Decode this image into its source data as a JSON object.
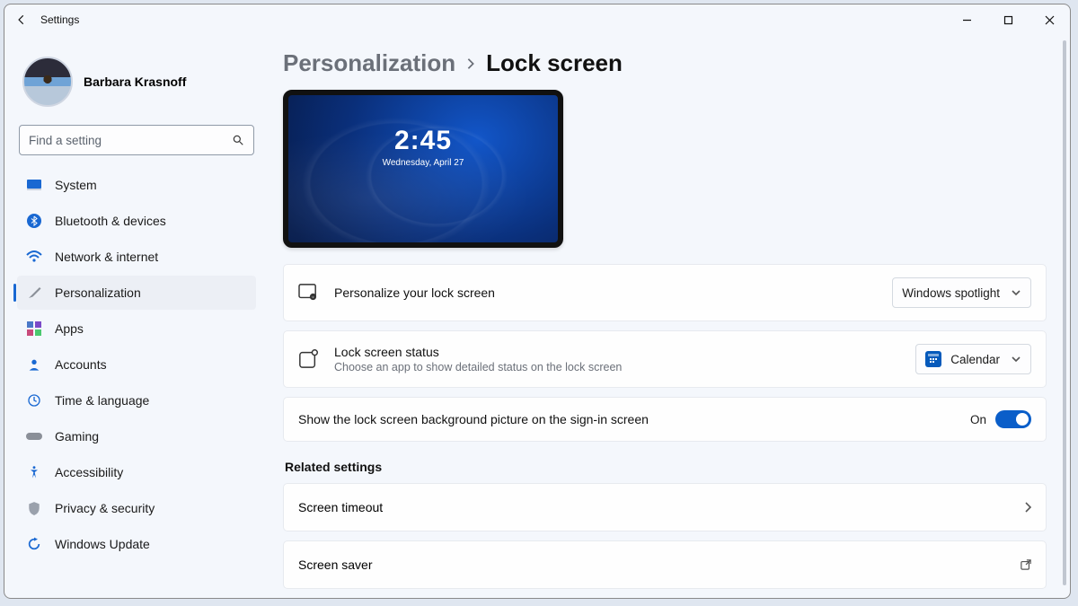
{
  "window": {
    "title": "Settings"
  },
  "profile": {
    "name": "Barbara Krasnoff"
  },
  "search": {
    "placeholder": "Find a setting"
  },
  "sidebar": {
    "items": [
      {
        "label": "System"
      },
      {
        "label": "Bluetooth & devices"
      },
      {
        "label": "Network & internet"
      },
      {
        "label": "Personalization"
      },
      {
        "label": "Apps"
      },
      {
        "label": "Accounts"
      },
      {
        "label": "Time & language"
      },
      {
        "label": "Gaming"
      },
      {
        "label": "Accessibility"
      },
      {
        "label": "Privacy & security"
      },
      {
        "label": "Windows Update"
      }
    ],
    "selected_index": 3
  },
  "breadcrumb": {
    "parent": "Personalization",
    "current": "Lock screen"
  },
  "preview": {
    "time": "2:45",
    "date": "Wednesday, April 27"
  },
  "cards": {
    "personalize": {
      "title": "Personalize your lock screen",
      "select_value": "Windows spotlight"
    },
    "status": {
      "title": "Lock screen status",
      "sub": "Choose an app to show detailed status on the lock screen",
      "select_value": "Calendar"
    },
    "signin_picture": {
      "title": "Show the lock screen background picture on the sign-in screen",
      "toggle_label": "On",
      "toggle_on": true
    }
  },
  "related": {
    "heading": "Related settings",
    "items": [
      {
        "label": "Screen timeout"
      },
      {
        "label": "Screen saver"
      }
    ]
  }
}
